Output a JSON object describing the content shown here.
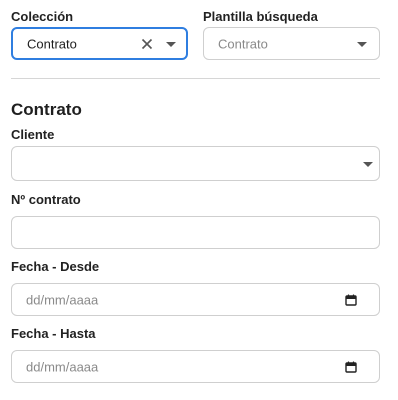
{
  "coleccion": {
    "label": "Colección",
    "value": "Contrato"
  },
  "plantilla": {
    "label": "Plantilla búsqueda",
    "placeholder": "Contrato"
  },
  "section_title": "Contrato",
  "cliente": {
    "label": "Cliente",
    "value": ""
  },
  "num_contrato": {
    "label": "Nº contrato",
    "value": ""
  },
  "fecha_desde": {
    "label": "Fecha - Desde",
    "placeholder": "dd/mm/aaaa"
  },
  "fecha_hasta": {
    "label": "Fecha - Hasta",
    "placeholder": "dd/mm/aaaa"
  },
  "colors": {
    "focus_border": "#2f7ee0",
    "border": "#cfcfcf",
    "placeholder": "#8a8a8a"
  }
}
